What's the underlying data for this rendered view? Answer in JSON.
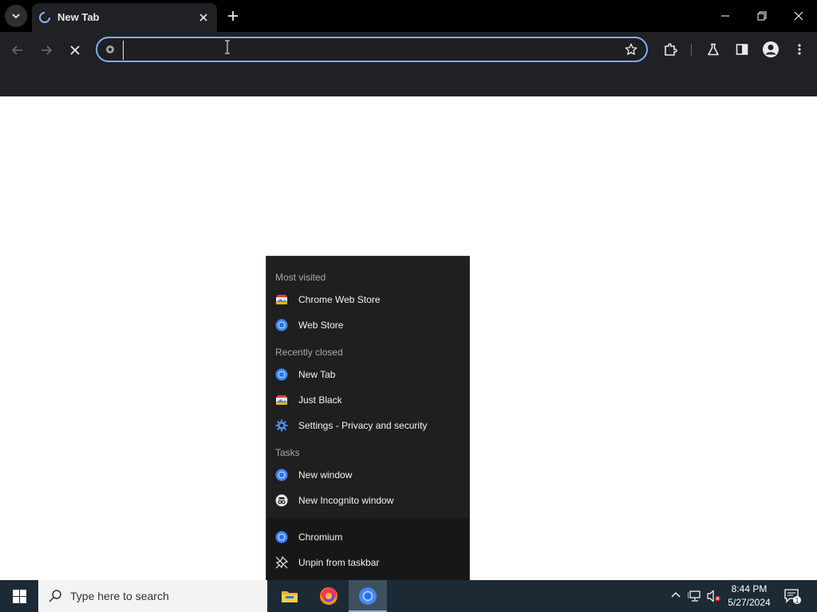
{
  "browser": {
    "tab": {
      "title": "New Tab"
    },
    "omnibox": {
      "value": "",
      "placeholder": ""
    }
  },
  "jumplist": {
    "sections": [
      {
        "header": "Most visited",
        "items": [
          {
            "label": "Chrome Web Store",
            "icon": "webstore-icon"
          },
          {
            "label": "Web Store",
            "icon": "chromium-icon"
          }
        ]
      },
      {
        "header": "Recently closed",
        "items": [
          {
            "label": "New Tab",
            "icon": "chromium-icon"
          },
          {
            "label": "Just Black",
            "icon": "webstore-icon"
          },
          {
            "label": "Settings - Privacy and security",
            "icon": "gear-icon"
          }
        ]
      },
      {
        "header": "Tasks",
        "items": [
          {
            "label": "New window",
            "icon": "chromium-icon"
          },
          {
            "label": "New Incognito window",
            "icon": "incognito-icon"
          }
        ]
      }
    ],
    "app": {
      "label": "Chromium"
    },
    "unpin": {
      "label": "Unpin from taskbar"
    }
  },
  "taskbar": {
    "search_placeholder": "Type here to search",
    "apps": [
      "file-explorer-icon",
      "firefox-icon",
      "chromium-icon"
    ],
    "clock": {
      "time": "8:44 PM",
      "date": "5/27/2024"
    },
    "notifications": {
      "count": "1"
    }
  },
  "colors": {
    "accent": "#7cacf8",
    "toolbar": "#202124",
    "taskbar": "#1c2a36",
    "menu": "#1f1f1f"
  }
}
